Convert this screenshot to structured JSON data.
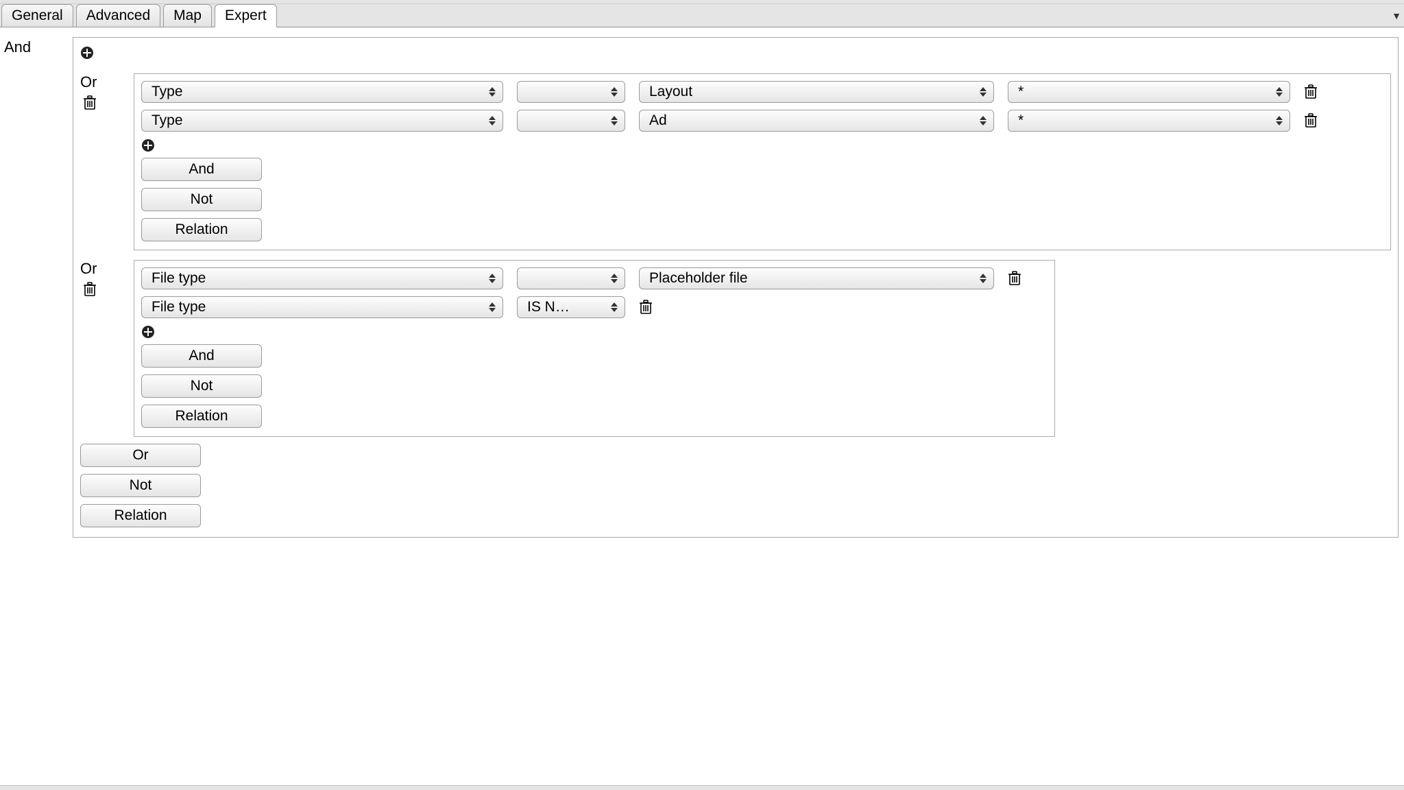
{
  "tabs": {
    "general": "General",
    "advanced": "Advanced",
    "map": "Map",
    "expert": "Expert",
    "active": "expert"
  },
  "root": {
    "label": "And",
    "buttons": {
      "or": "Or",
      "not": "Not",
      "relation": "Relation"
    }
  },
  "group1": {
    "label": "Or",
    "rows": [
      {
        "field": "Type",
        "op": "",
        "value": "Layout",
        "extra": "*"
      },
      {
        "field": "Type",
        "op": "",
        "value": "Ad",
        "extra": "*"
      }
    ],
    "buttons": {
      "and": "And",
      "not": "Not",
      "relation": "Relation"
    }
  },
  "group2": {
    "label": "Or",
    "rows": [
      {
        "field": "File type",
        "op": "",
        "value": "Placeholder file"
      },
      {
        "field": "File type",
        "op": "IS N…"
      }
    ],
    "buttons": {
      "and": "And",
      "not": "Not",
      "relation": "Relation"
    }
  }
}
